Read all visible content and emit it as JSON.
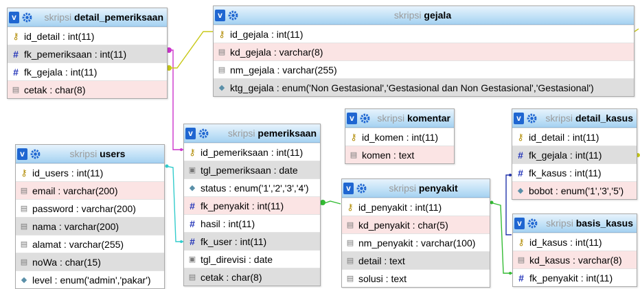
{
  "colors": {
    "header_top": "#e7f3fc",
    "header_bottom": "#a6d2f1",
    "fk_pink": "#fbe4e4",
    "fk_grey": "#dedede",
    "v_button": "#1f66d1"
  },
  "tables": {
    "detail_pemeriksaan": {
      "db": "skripsi",
      "name": "detail_pemeriksaan",
      "columns": [
        {
          "icon": "key-icon",
          "text": "id_detail : int(11)",
          "style": ""
        },
        {
          "icon": "hash-icon",
          "text": "fk_pemeriksaan : int(11)",
          "style": "grey"
        },
        {
          "icon": "hash-icon",
          "text": "fk_gejala : int(11)",
          "style": ""
        },
        {
          "icon": "index-icon",
          "text": "cetak : char(8)",
          "style": "pink"
        }
      ]
    },
    "gejala": {
      "db": "skripsi",
      "name": "gejala",
      "columns": [
        {
          "icon": "key-icon",
          "text": "id_gejala : int(11)",
          "style": ""
        },
        {
          "icon": "index-icon",
          "text": "kd_gejala : varchar(8)",
          "style": "pink"
        },
        {
          "icon": "index-icon",
          "text": "nm_gejala : varchar(255)",
          "style": ""
        },
        {
          "icon": "diamond-icon",
          "text": "ktg_gejala : enum('Non Gestasional','Gestasional dan Non Gestasional','Gestasional')",
          "style": "grey"
        }
      ]
    },
    "pemeriksaan": {
      "db": "skripsi",
      "name": "pemeriksaan",
      "columns": [
        {
          "icon": "key-icon",
          "text": "id_pemeriksaan : int(11)",
          "style": ""
        },
        {
          "icon": "calendar-icon",
          "text": "tgl_pemeriksaan : date",
          "style": "grey"
        },
        {
          "icon": "diamond-icon",
          "text": "status : enum('1','2','3','4')",
          "style": ""
        },
        {
          "icon": "hash-icon",
          "text": "fk_penyakit : int(11)",
          "style": "pink"
        },
        {
          "icon": "hash-icon",
          "text": "hasil : int(11)",
          "style": ""
        },
        {
          "icon": "hash-icon",
          "text": "fk_user : int(11)",
          "style": "grey"
        },
        {
          "icon": "calendar-icon",
          "text": "tgl_direvisi : date",
          "style": ""
        },
        {
          "icon": "index-icon",
          "text": "cetak : char(8)",
          "style": "grey"
        }
      ]
    },
    "komentar": {
      "db": "skripsi",
      "name": "komentar",
      "columns": [
        {
          "icon": "key-icon",
          "text": "id_komen : int(11)",
          "style": ""
        },
        {
          "icon": "index-icon",
          "text": "komen : text",
          "style": "pink"
        }
      ]
    },
    "detail_kasus": {
      "db": "skripsi",
      "name": "detail_kasus",
      "columns": [
        {
          "icon": "key-icon",
          "text": "id_detail : int(11)",
          "style": ""
        },
        {
          "icon": "hash-icon",
          "text": "fk_gejala : int(11)",
          "style": "grey"
        },
        {
          "icon": "hash-icon",
          "text": "fk_kasus : int(11)",
          "style": ""
        },
        {
          "icon": "diamond-icon",
          "text": "bobot : enum('1','3','5')",
          "style": "pink"
        }
      ]
    },
    "users": {
      "db": "skripsi",
      "name": "users",
      "columns": [
        {
          "icon": "key-icon",
          "text": "id_users : int(11)",
          "style": ""
        },
        {
          "icon": "index-icon",
          "text": "email : varchar(200)",
          "style": "pink"
        },
        {
          "icon": "index-icon",
          "text": "password : varchar(200)",
          "style": ""
        },
        {
          "icon": "index-icon",
          "text": "nama : varchar(200)",
          "style": "grey"
        },
        {
          "icon": "index-icon",
          "text": "alamat : varchar(255)",
          "style": ""
        },
        {
          "icon": "index-icon",
          "text": "noWa : char(15)",
          "style": "grey"
        },
        {
          "icon": "diamond-icon",
          "text": "level : enum('admin','pakar')",
          "style": ""
        }
      ]
    },
    "penyakit": {
      "db": "skripsi",
      "name": "penyakit",
      "columns": [
        {
          "icon": "key-icon",
          "text": "id_penyakit : int(11)",
          "style": ""
        },
        {
          "icon": "index-icon",
          "text": "kd_penyakit : char(5)",
          "style": "pink"
        },
        {
          "icon": "index-icon",
          "text": "nm_penyakit : varchar(100)",
          "style": ""
        },
        {
          "icon": "index-icon",
          "text": "detail : text",
          "style": "grey"
        },
        {
          "icon": "index-icon",
          "text": "solusi : text",
          "style": ""
        }
      ]
    },
    "basis_kasus": {
      "db": "skripsi",
      "name": "basis_kasus",
      "columns": [
        {
          "icon": "key-icon",
          "text": "id_kasus : int(11)",
          "style": ""
        },
        {
          "icon": "index-icon",
          "text": "kd_kasus : varchar(8)",
          "style": "pink"
        },
        {
          "icon": "hash-icon",
          "text": "fk_penyakit : int(11)",
          "style": ""
        }
      ]
    }
  },
  "relations": [
    {
      "from": "detail_pemeriksaan.fk_pemeriksaan",
      "to": "pemeriksaan.id_pemeriksaan",
      "color": "#cc33cc"
    },
    {
      "from": "detail_pemeriksaan.fk_gejala",
      "to": "gejala.id_gejala",
      "color": "#c8c818"
    },
    {
      "from": "pemeriksaan.fk_user",
      "to": "users.id_users",
      "color": "#33cccc"
    },
    {
      "from": "pemeriksaan.fk_penyakit",
      "to": "penyakit.id_penyakit",
      "color": "#33bb33"
    },
    {
      "from": "basis_kasus.fk_penyakit",
      "to": "penyakit.id_penyakit",
      "color": "#33bb33"
    },
    {
      "from": "detail_kasus.fk_kasus",
      "to": "basis_kasus.id_kasus",
      "color": "#2233aa"
    },
    {
      "from": "detail_kasus.fk_gejala",
      "to": "gejala.id_gejala",
      "color": "#c8c818"
    }
  ]
}
